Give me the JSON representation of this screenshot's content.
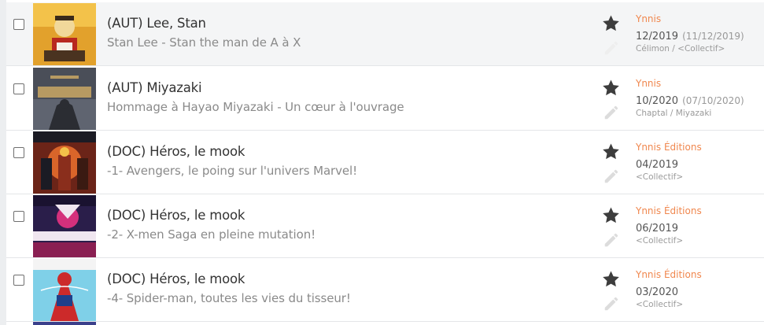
{
  "items": [
    {
      "title": "(AUT) Lee, Stan",
      "subtitle": "Stan Lee - Stan the man de A à X",
      "publisher": "Ynnis",
      "date": "12/2019",
      "full_date": "(11/12/2019)",
      "authors": "Célimon / <Collectif>",
      "cover_colors": [
        "#e2a12c",
        "#b8281f",
        "#f1d89a"
      ]
    },
    {
      "title": "(AUT) Miyazaki",
      "subtitle": "Hommage à Hayao Miyazaki - Un cœur à l'ouvrage",
      "publisher": "Ynnis",
      "date": "10/2020",
      "full_date": "(07/10/2020)",
      "authors": "Chaptal / Miyazaki",
      "cover_colors": [
        "#5f6470",
        "#b79a62",
        "#2b2d33"
      ]
    },
    {
      "title": "(DOC) Héros, le mook",
      "subtitle": "-1- Avengers, le poing sur l'univers Marvel!",
      "publisher": "Ynnis Éditions",
      "date": "04/2019",
      "full_date": "",
      "authors": "<Collectif>",
      "cover_colors": [
        "#6b2418",
        "#d9652a",
        "#1b1b24"
      ]
    },
    {
      "title": "(DOC) Héros, le mook",
      "subtitle": "-2- X-men Saga en pleine mutation!",
      "publisher": "Ynnis Éditions",
      "date": "06/2019",
      "full_date": "",
      "authors": "<Collectif>",
      "cover_colors": [
        "#2a1e4a",
        "#d4307c",
        "#f0e6f0"
      ]
    },
    {
      "title": "(DOC) Héros, le mook",
      "subtitle": "-4- Spider-man, toutes les vies du tisseur!",
      "publisher": "Ynnis Éditions",
      "date": "03/2020",
      "full_date": "",
      "authors": "<Collectif>",
      "cover_colors": [
        "#7fd0e8",
        "#cc2a2a",
        "#1e3f8a"
      ]
    }
  ]
}
